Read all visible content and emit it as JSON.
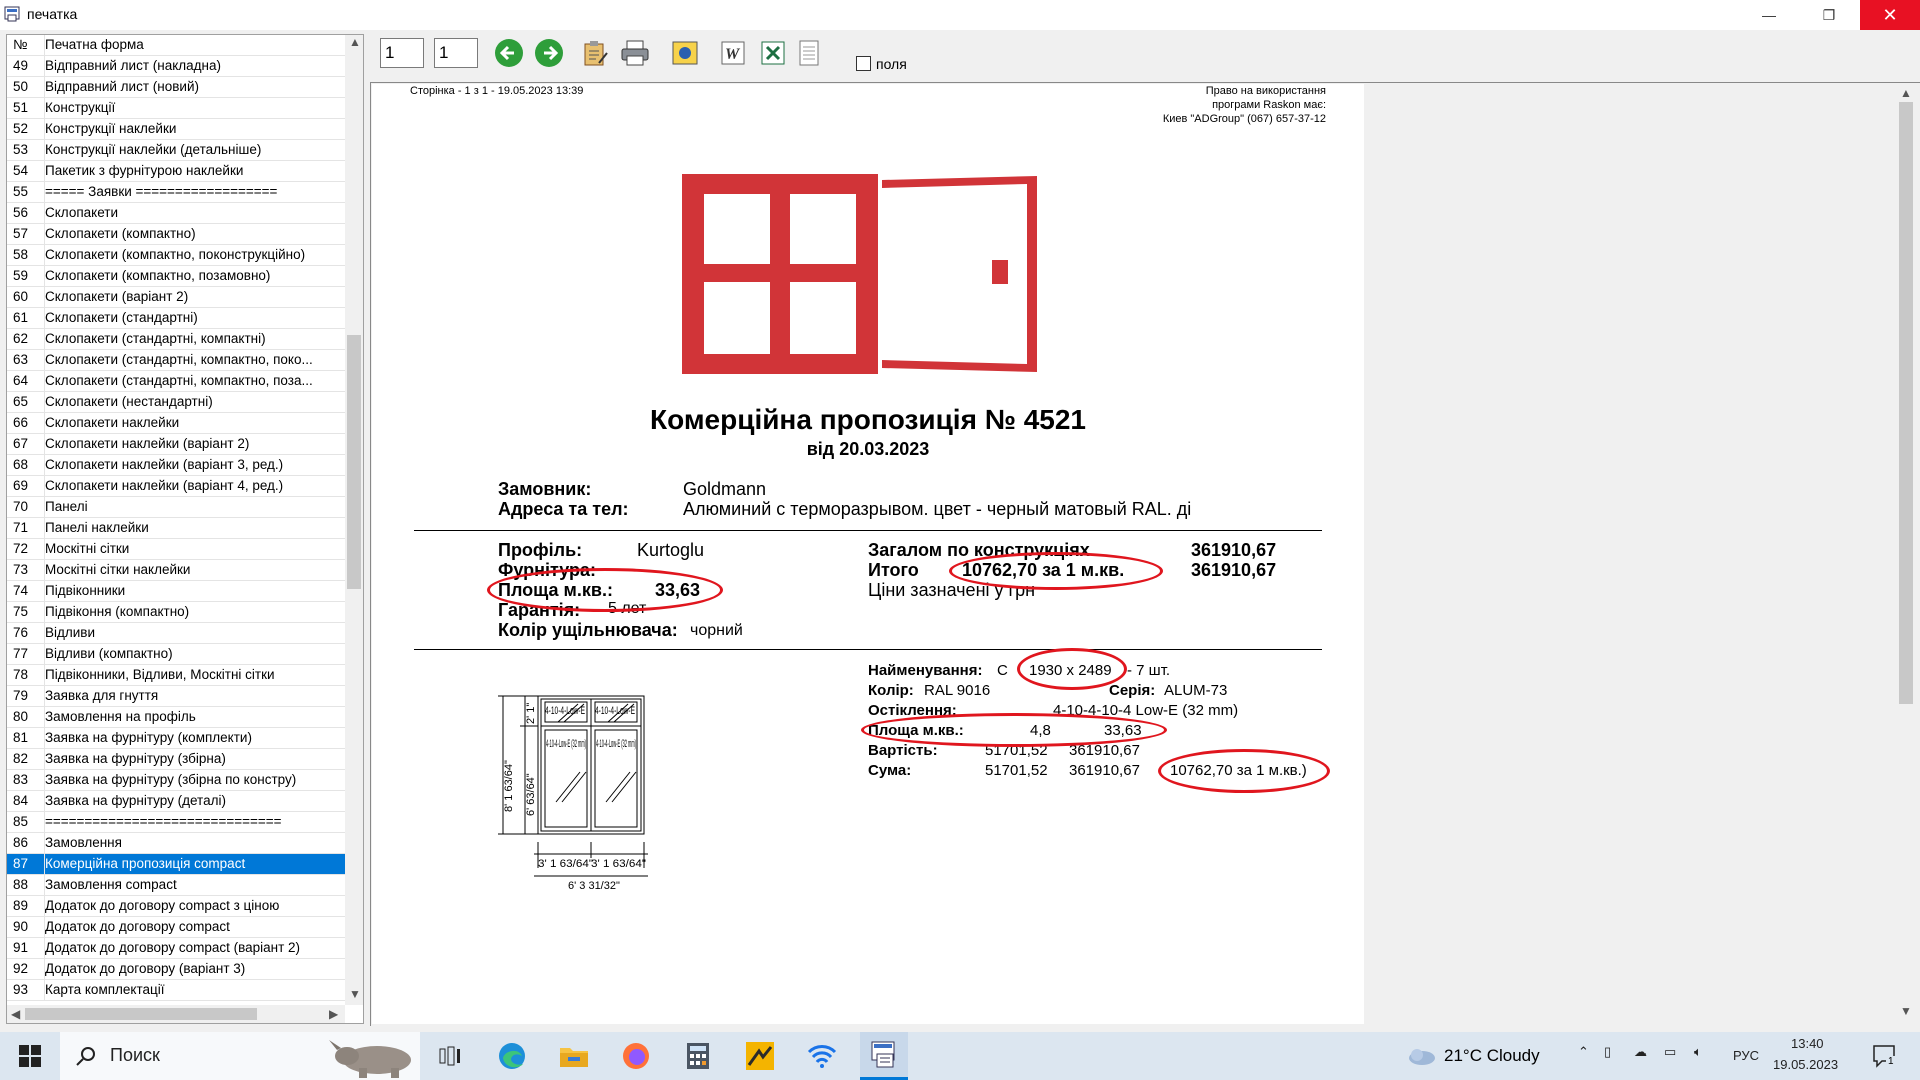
{
  "window": {
    "title": "печатка"
  },
  "window_controls": {
    "minimize": "—",
    "maximize": "❐",
    "close": "✕"
  },
  "list": {
    "header_num": "№",
    "header_title": "Печатна форма",
    "selected_index": 38,
    "rows": [
      {
        "n": "49",
        "t": "Відправний лист (накладна)"
      },
      {
        "n": "50",
        "t": "Відправний лист (новий)"
      },
      {
        "n": "51",
        "t": "Конструкції"
      },
      {
        "n": "52",
        "t": "Конструкції наклейки"
      },
      {
        "n": "53",
        "t": "Конструкції наклейки (детальніше)"
      },
      {
        "n": "54",
        "t": "Пакетик з фурнітурою наклейки"
      },
      {
        "n": "55",
        "t": "===== Заявки =================="
      },
      {
        "n": "56",
        "t": "Склопакети"
      },
      {
        "n": "57",
        "t": "Склопакети (компактно)"
      },
      {
        "n": "58",
        "t": "Склопакети (компактно, поконструкційно)"
      },
      {
        "n": "59",
        "t": "Склопакети (компактно, позамовно)"
      },
      {
        "n": "60",
        "t": "Склопакети (варіант 2)"
      },
      {
        "n": "61",
        "t": "Склопакети (стандартні)"
      },
      {
        "n": "62",
        "t": "Склопакети (стандартні, компактні)"
      },
      {
        "n": "63",
        "t": "Склопакети (стандартні, компактно, поко..."
      },
      {
        "n": "64",
        "t": "Склопакети (стандартні, компактно, поза..."
      },
      {
        "n": "65",
        "t": "Склопакети (нестандартні)"
      },
      {
        "n": "66",
        "t": "Склопакети наклейки"
      },
      {
        "n": "67",
        "t": "Склопакети наклейки (варіант 2)"
      },
      {
        "n": "68",
        "t": "Склопакети наклейки (варіант 3, ред.)"
      },
      {
        "n": "69",
        "t": "Склопакети наклейки (варіант 4, ред.)"
      },
      {
        "n": "70",
        "t": "Панелі"
      },
      {
        "n": "71",
        "t": "Панелі наклейки"
      },
      {
        "n": "72",
        "t": "Москітні сітки"
      },
      {
        "n": "73",
        "t": "Москітні сітки наклейки"
      },
      {
        "n": "74",
        "t": "Підвіконники"
      },
      {
        "n": "75",
        "t": "Підвіконня (компактно)"
      },
      {
        "n": "76",
        "t": "Відливи"
      },
      {
        "n": "77",
        "t": "Відливи (компактно)"
      },
      {
        "n": "78",
        "t": "Підвіконники, Відливи, Москітні сітки"
      },
      {
        "n": "79",
        "t": "Заявка для гнуття"
      },
      {
        "n": "80",
        "t": "Замовлення на профіль"
      },
      {
        "n": "81",
        "t": "Заявка на фурнітуру (комплекти)"
      },
      {
        "n": "82",
        "t": "Заявка на фурнітуру (збірна)"
      },
      {
        "n": "83",
        "t": "Заявка на фурнітуру (збірна по констру)"
      },
      {
        "n": "84",
        "t": "Заявка на фурнітуру (деталі)"
      },
      {
        "n": "85",
        "t": "=============================="
      },
      {
        "n": "86",
        "t": "Замовлення"
      },
      {
        "n": "87",
        "t": "Комерційна пропозиція compact"
      },
      {
        "n": "88",
        "t": "Замовлення compact"
      },
      {
        "n": "89",
        "t": "Додаток до договору compact з ціною"
      },
      {
        "n": "90",
        "t": "Додаток до договору compact"
      },
      {
        "n": "91",
        "t": "Додаток до договору compact (варіант 2)"
      },
      {
        "n": "92",
        "t": "Додаток до договору (варіант 3)"
      },
      {
        "n": "93",
        "t": "Карта комплектації"
      }
    ]
  },
  "toolbar": {
    "page_from": "1",
    "page_to": "1",
    "fields_label": "поля",
    "fields_checked": false
  },
  "doc": {
    "page_info": "Сторінка - 1 з 1 - 19.05.2023 13:39",
    "license_line1": "Право на використання",
    "license_line2": "програми Raskon має:",
    "license_line3": "Киев  \"ADGroup\"  (067) 657-37-12",
    "title": "Комерційна пропозиція № 4521",
    "date": "від 20.03.2023",
    "customer_label": "Замовник:",
    "customer_value": "Goldmann",
    "address_label": "Адреса та тел:",
    "address_value": "Алюминий с терморазрывом. цвет - черный матовый RAL. ді",
    "profile_label": "Профіль:",
    "profile_value": "Kurtoglu",
    "hardware_label": "Фурнітура:",
    "area_label": "Площа м.кв.:",
    "area_value": "33,63",
    "warranty_label": "Гарантія:",
    "warranty_value": "5 лет",
    "seal_color_label": "Колір ущільнювача:",
    "seal_color_value": "чорний",
    "total_constructions_label": "Загалом по конструкціях",
    "total_constructions_value": "361910,67",
    "itogo_label": "Итого",
    "per_sqm": "10762,70 за 1 м.кв.",
    "itogo_value": "361910,67",
    "prices_note": "Ціни зазначені у грн",
    "item_name_label": "Найменування:",
    "item_name_prefix": "С",
    "item_size": "1930 x 2489",
    "item_qty": "- 7 шт.",
    "color_label": "Колір:",
    "color_value": "RAL 9016",
    "series_label": "Серія:",
    "series_value": "ALUM-73",
    "glazing_label": "Остіклення:",
    "glazing_value": "4-10-4-10-4 Low-E (32 mm)",
    "item_area_label": "Площа м.кв.:",
    "item_area_one": "4,8",
    "item_area_total": "33,63",
    "cost_label": "Вартість:",
    "cost_one": "51701,52",
    "cost_total": "361910,67",
    "sum_label": "Сума:",
    "sum_one": "51701,52",
    "sum_total": "361910,67",
    "sum_per_sqm": "10762,70 за 1 м.кв.)",
    "drawing": {
      "height_total": "8' 1 63/64\"",
      "height_top": "2' 1\"",
      "height_bottom": "6' 63/64\"",
      "width_left": "3' 1 63/64\"",
      "width_right": "3' 1 63/64\"",
      "width_total": "6' 3 31/32\"",
      "pane_top": "4-10-4-Low-E",
      "pane_bottom": "4-10-4-Low-E (32 mm)"
    }
  },
  "taskbar": {
    "search_placeholder": "Поиск",
    "weather": "21°C  Cloudy",
    "lang": "РУС",
    "time": "13:40",
    "date": "19.05.2023",
    "notifications": "1"
  },
  "colors": {
    "accent": "#0078d7",
    "logo_red": "#d13438",
    "annotation_red": "#e0161e",
    "close_red": "#e81123"
  }
}
